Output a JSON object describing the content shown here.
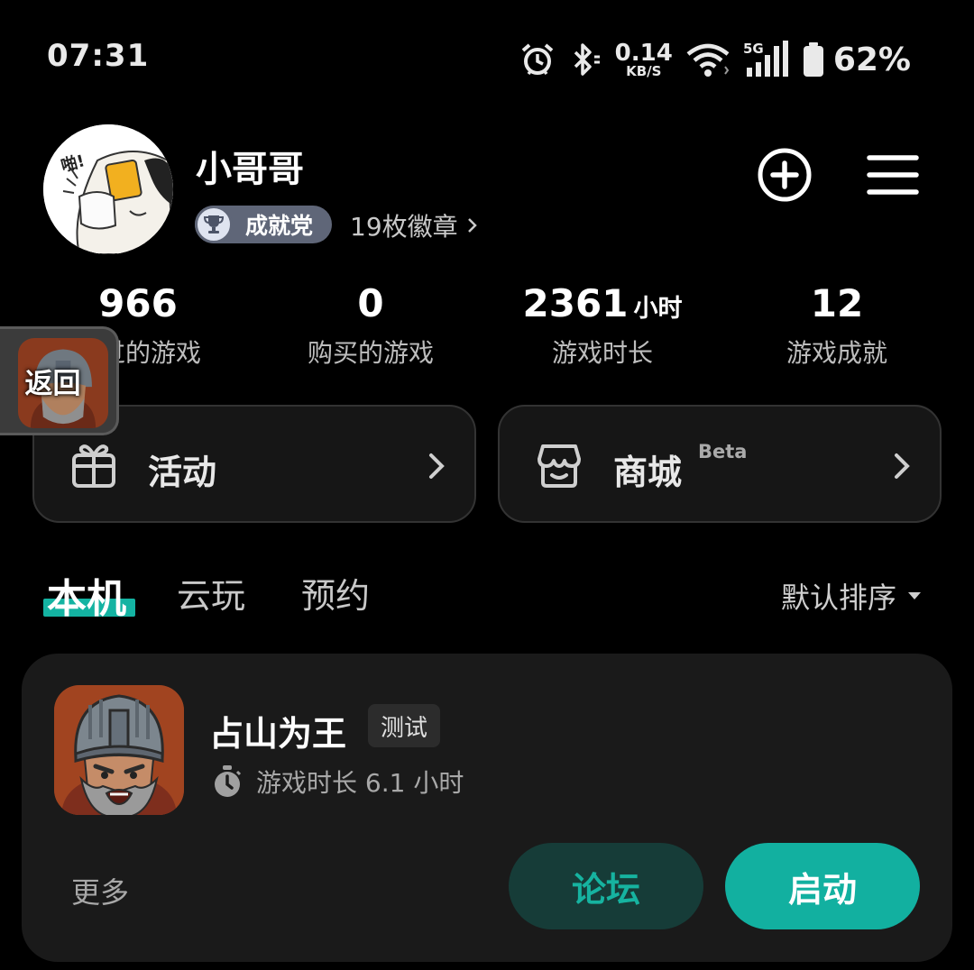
{
  "status_bar": {
    "time": "07:31",
    "net_speed_value": "0.14",
    "net_speed_unit": "KB/S",
    "network_type": "5G",
    "battery": "62%",
    "icons": [
      "alarm-icon",
      "bluetooth-icon",
      "wifi-icon",
      "signal-icon",
      "battery-icon"
    ]
  },
  "profile": {
    "username": "小哥哥",
    "badge_label": "成就党",
    "badge_count": "19枚徽章"
  },
  "stats": [
    {
      "value": "966",
      "unit": "",
      "caption": "玩过的游戏"
    },
    {
      "value": "0",
      "unit": "",
      "caption": "购买的游戏"
    },
    {
      "value": "2361",
      "unit": "小时",
      "caption": "游戏时长"
    },
    {
      "value": "12",
      "unit": "",
      "caption": "游戏成就"
    }
  ],
  "floating_back": {
    "label": "返回"
  },
  "cards": {
    "activity": {
      "label": "活动"
    },
    "store": {
      "label": "商城",
      "tag": "Beta"
    }
  },
  "tabs": {
    "items": [
      "本机",
      "云玩",
      "预约"
    ],
    "active": "本机",
    "sort_label": "默认排序"
  },
  "game": {
    "title": "占山为王",
    "tag": "测试",
    "playtime": "游戏时长 6.1 小时",
    "more_label": "更多",
    "forum_label": "论坛",
    "start_label": "启动"
  },
  "colors": {
    "accent": "#12b0a0",
    "background": "#000000",
    "card": "#1a1a1a"
  }
}
